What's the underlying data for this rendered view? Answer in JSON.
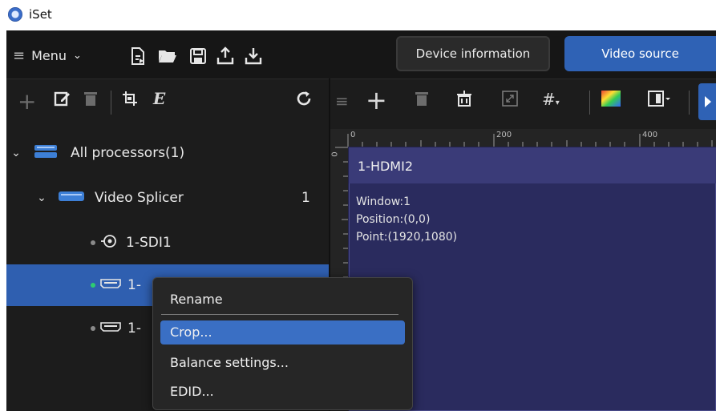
{
  "window": {
    "title": "iSet"
  },
  "menubar": {
    "menu_label": "Menu",
    "icons": [
      "new-file-icon",
      "open-folder-icon",
      "save-icon",
      "upload-icon",
      "download-icon"
    ]
  },
  "tabs": [
    {
      "label": "Device information",
      "active": false
    },
    {
      "label": "Video source",
      "active": true
    }
  ],
  "tree": {
    "root": {
      "label": "All processors(1)"
    },
    "processor": {
      "label": "Video Splicer",
      "count": "1"
    },
    "sources": [
      {
        "label": "1-SDI1",
        "status": "gray",
        "icon": "sdi-icon"
      },
      {
        "label": "1-",
        "status": "green",
        "icon": "hdmi-icon",
        "selected": true
      },
      {
        "label": "1-",
        "status": "gray",
        "icon": "hdmi-icon"
      }
    ]
  },
  "ruler": {
    "top_marks": [
      "0",
      "200",
      "400"
    ],
    "left_marks": [
      "0"
    ]
  },
  "canvas": {
    "window_title": "1-HDMI2",
    "lines": [
      "Window:1",
      "Position:(0,0)",
      "Point:(1920,1080)"
    ]
  },
  "context_menu": {
    "items": [
      {
        "label": "Rename",
        "highlighted": false
      },
      {
        "label": "Crop...",
        "highlighted": true
      },
      {
        "label": "Balance settings...",
        "highlighted": false
      },
      {
        "label": "EDID...",
        "highlighted": false
      }
    ]
  },
  "colors": {
    "accent": "#2f62b5",
    "canvas": "#2a2b5e",
    "status_green": "#2ecc71"
  }
}
